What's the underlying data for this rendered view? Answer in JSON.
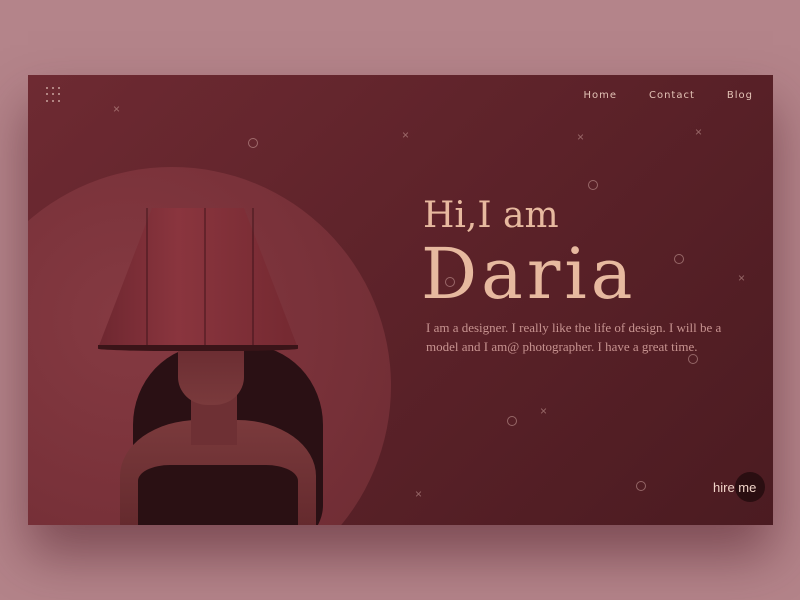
{
  "nav": {
    "menu_icon": "grid-menu-icon",
    "links": [
      "Home",
      "Contact",
      "Blog"
    ]
  },
  "hero": {
    "greeting": "Hi,I am",
    "name": "Daria",
    "bio": "I am a designer. I really like the life of design. I will be a model and I am@ photographer. I have a great time.",
    "cta": "hire me"
  },
  "colors": {
    "page_bg": "#b4848a",
    "card_bg": "#5c2229",
    "accent_text": "#e7b99f",
    "body_text": "#c79390"
  }
}
